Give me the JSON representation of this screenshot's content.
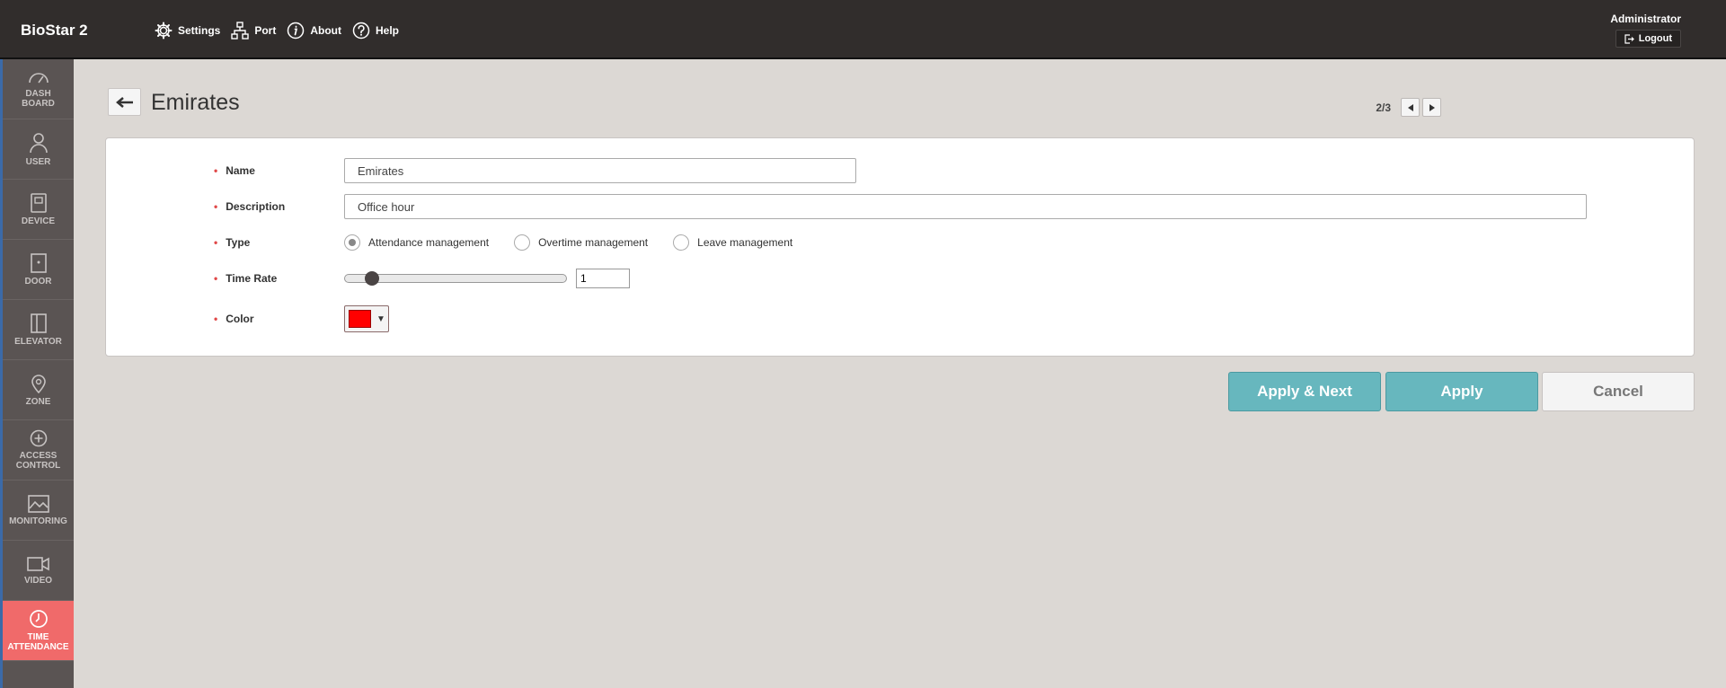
{
  "app": {
    "brand": "BioStar 2"
  },
  "topnav": [
    {
      "label": "Settings",
      "icon": "gear-icon"
    },
    {
      "label": "Port",
      "icon": "network-icon"
    },
    {
      "label": "About",
      "icon": "info-icon"
    },
    {
      "label": "Help",
      "icon": "help-icon"
    }
  ],
  "user": {
    "name": "Administrator",
    "logout_label": "Logout"
  },
  "sidebar": [
    {
      "line1": "DASH",
      "line2": "BOARD",
      "icon": "dashboard-icon"
    },
    {
      "line1": "USER",
      "line2": "",
      "icon": "user-icon"
    },
    {
      "line1": "DEVICE",
      "line2": "",
      "icon": "device-icon"
    },
    {
      "line1": "DOOR",
      "line2": "",
      "icon": "door-icon"
    },
    {
      "line1": "ELEVATOR",
      "line2": "",
      "icon": "elevator-icon"
    },
    {
      "line1": "ZONE",
      "line2": "",
      "icon": "zone-icon"
    },
    {
      "line1": "ACCESS",
      "line2": "CONTROL",
      "icon": "access-control-icon"
    },
    {
      "line1": "MONITORING",
      "line2": "",
      "icon": "monitoring-icon"
    },
    {
      "line1": "VIDEO",
      "line2": "",
      "icon": "video-icon"
    },
    {
      "line1": "TIME",
      "line2": "ATTENDANCE",
      "icon": "clock-icon",
      "active": true
    }
  ],
  "page": {
    "title": "Emirates",
    "pager": "2/3"
  },
  "form": {
    "name": {
      "label": "Name",
      "value": "Emirates"
    },
    "description": {
      "label": "Description",
      "value": "Office hour"
    },
    "type": {
      "label": "Type",
      "options": [
        "Attendance management",
        "Overtime management",
        "Leave management"
      ],
      "selected": "Attendance management"
    },
    "time_rate": {
      "label": "Time Rate",
      "value": "1",
      "slider_fraction": 0.05
    },
    "color": {
      "label": "Color",
      "value": "#ff0000"
    }
  },
  "buttons": {
    "apply_next": "Apply & Next",
    "apply": "Apply",
    "cancel": "Cancel"
  },
  "colors": {
    "accent": "#67b7be",
    "active_nav": "#f06a6a",
    "topbar": "#312d2c",
    "sidebar": "#5a5453"
  }
}
